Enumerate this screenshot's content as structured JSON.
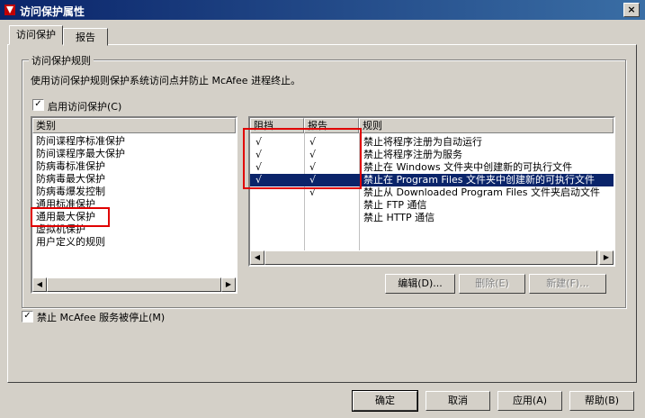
{
  "window": {
    "title": "访问保护属性",
    "close_label": "×"
  },
  "tabs": [
    {
      "label": "访问保护",
      "active": true
    },
    {
      "label": "报告",
      "active": false
    }
  ],
  "group": {
    "legend": "访问保护规则",
    "description": "使用访问保护规则保护系统访问点并防止 McAfee 进程终止。",
    "enable_checkbox": {
      "label": "启用访问保护(C)",
      "checked": true,
      "mark": "✓"
    }
  },
  "category": {
    "header": "类别",
    "items": [
      {
        "label": "防间谍程序标准保护",
        "selected": false
      },
      {
        "label": "防间谍程序最大保护",
        "selected": false
      },
      {
        "label": "防病毒标准保护",
        "selected": false
      },
      {
        "label": "防病毒最大保护",
        "selected": false
      },
      {
        "label": "防病毒爆发控制",
        "selected": false
      },
      {
        "label": "通用标准保护",
        "selected": false
      },
      {
        "label": "通用最大保护",
        "selected": false
      },
      {
        "label": "虚拟机保护",
        "selected": false
      },
      {
        "label": "用户定义的规则",
        "selected": false
      }
    ]
  },
  "rules": {
    "headers": {
      "block": "阻挡",
      "report": "报告",
      "rule": "规则"
    },
    "rows": [
      {
        "block": "√",
        "report": "√",
        "rule": "禁止将程序注册为自动运行",
        "selected": false
      },
      {
        "block": "√",
        "report": "√",
        "rule": "禁止将程序注册为服务",
        "selected": false
      },
      {
        "block": "√",
        "report": "√",
        "rule": "禁止在 Windows 文件夹中创建新的可执行文件",
        "selected": false
      },
      {
        "block": "√",
        "report": "√",
        "rule": "禁止在 Program Files 文件夹中创建新的可执行文件",
        "selected": true
      },
      {
        "block": "",
        "report": "√",
        "rule": "禁止从 Downloaded Program Files 文件夹启动文件",
        "selected": false
      },
      {
        "block": "",
        "report": "",
        "rule": "禁止 FTP 通信",
        "selected": false
      },
      {
        "block": "",
        "report": "",
        "rule": "禁止 HTTP 通信",
        "selected": false
      }
    ]
  },
  "rule_buttons": {
    "edit": "编辑(D)...",
    "delete": "删除(E)",
    "new": "新建(F)..."
  },
  "stop_service": {
    "label": "禁止 McAfee 服务被停止(M)",
    "checked": true,
    "mark": "✓"
  },
  "footer": {
    "ok": "确定",
    "cancel": "取消",
    "apply": "应用(A)",
    "help": "帮助(B)"
  },
  "scroll_arrows": {
    "left": "◀",
    "right": "▶"
  },
  "colors": {
    "titlebar_start": "#0a246a",
    "selection": "#0a246a",
    "annotation_red": "#e00000",
    "dialog_face": "#d4d0c8"
  }
}
